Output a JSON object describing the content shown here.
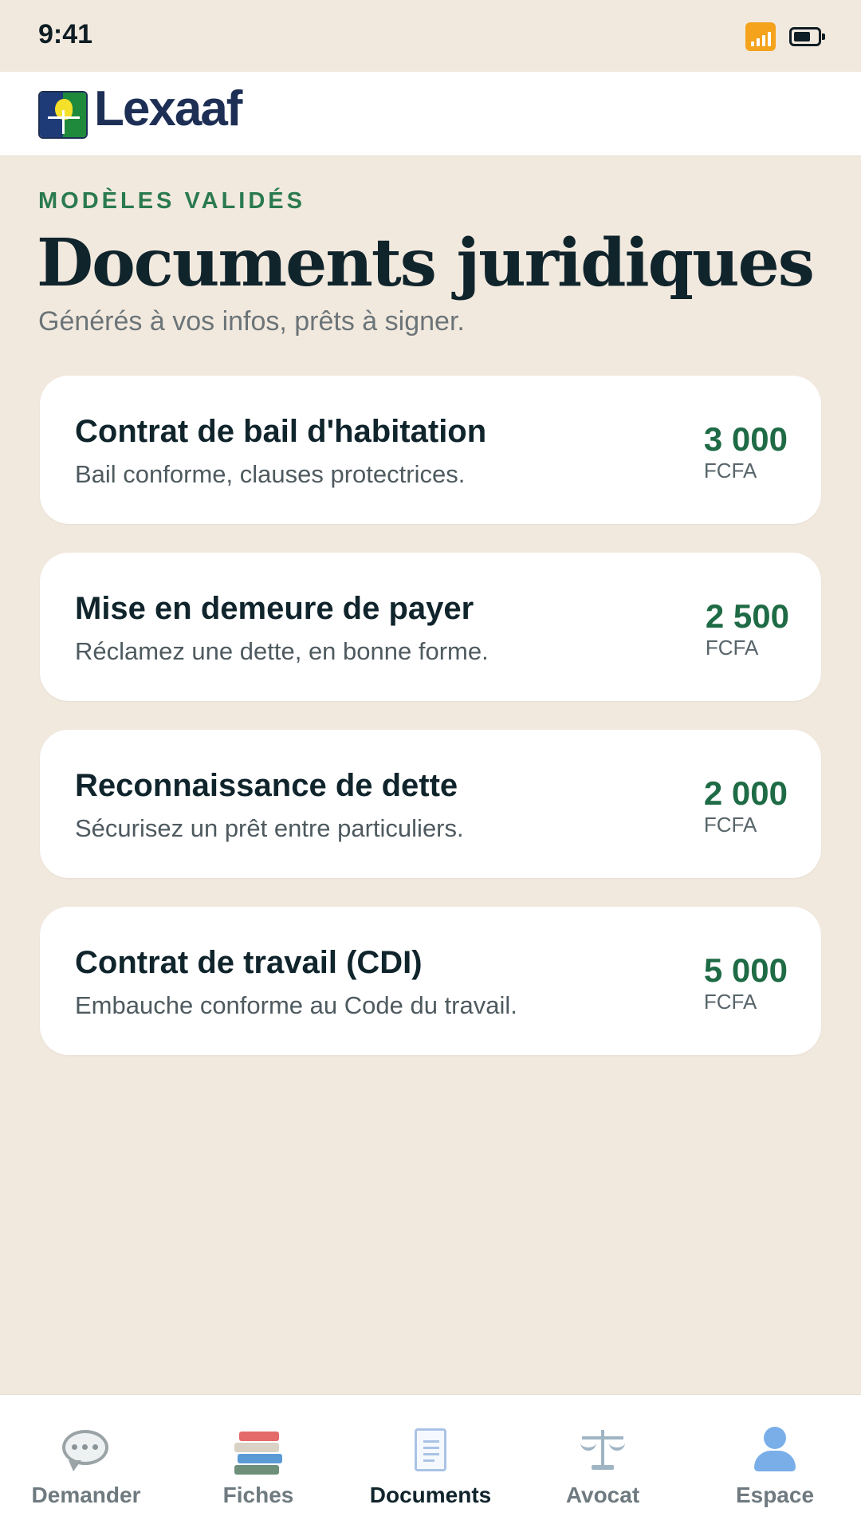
{
  "status_bar": {
    "time": "9:41"
  },
  "header": {
    "logo_text": "Lexaaf"
  },
  "page": {
    "eyebrow": "MODÈLES VALIDÉS",
    "title": "Documents juridiques",
    "subtitle": "Générés à vos infos, prêts à signer."
  },
  "documents": [
    {
      "title": "Contrat de bail d'habitation",
      "description": "Bail conforme, clauses protectrices.",
      "price": "3 000",
      "currency": "FCFA"
    },
    {
      "title": "Mise en demeure de payer",
      "description": "Réclamez une dette, en bonne forme.",
      "price": "2 500",
      "currency": "FCFA"
    },
    {
      "title": "Reconnaissance de dette",
      "description": "Sécurisez un prêt entre particuliers.",
      "price": "2 000",
      "currency": "FCFA"
    },
    {
      "title": "Contrat de travail (CDI)",
      "description": "Embauche conforme au Code du travail.",
      "price": "5 000",
      "currency": "FCFA"
    }
  ],
  "tab_bar": {
    "active": "Documents",
    "tabs": [
      {
        "label": "Demander",
        "icon": "speech-bubble-icon"
      },
      {
        "label": "Fiches",
        "icon": "books-icon"
      },
      {
        "label": "Documents",
        "icon": "document-icon"
      },
      {
        "label": "Avocat",
        "icon": "scales-icon"
      },
      {
        "label": "Espace",
        "icon": "person-icon"
      }
    ]
  },
  "colors": {
    "background": "#f2e9de",
    "accent_green": "#2a7a4f",
    "price_green": "#1e6b45",
    "text_dark": "#10242c",
    "brand_navy": "#1e2f55"
  }
}
